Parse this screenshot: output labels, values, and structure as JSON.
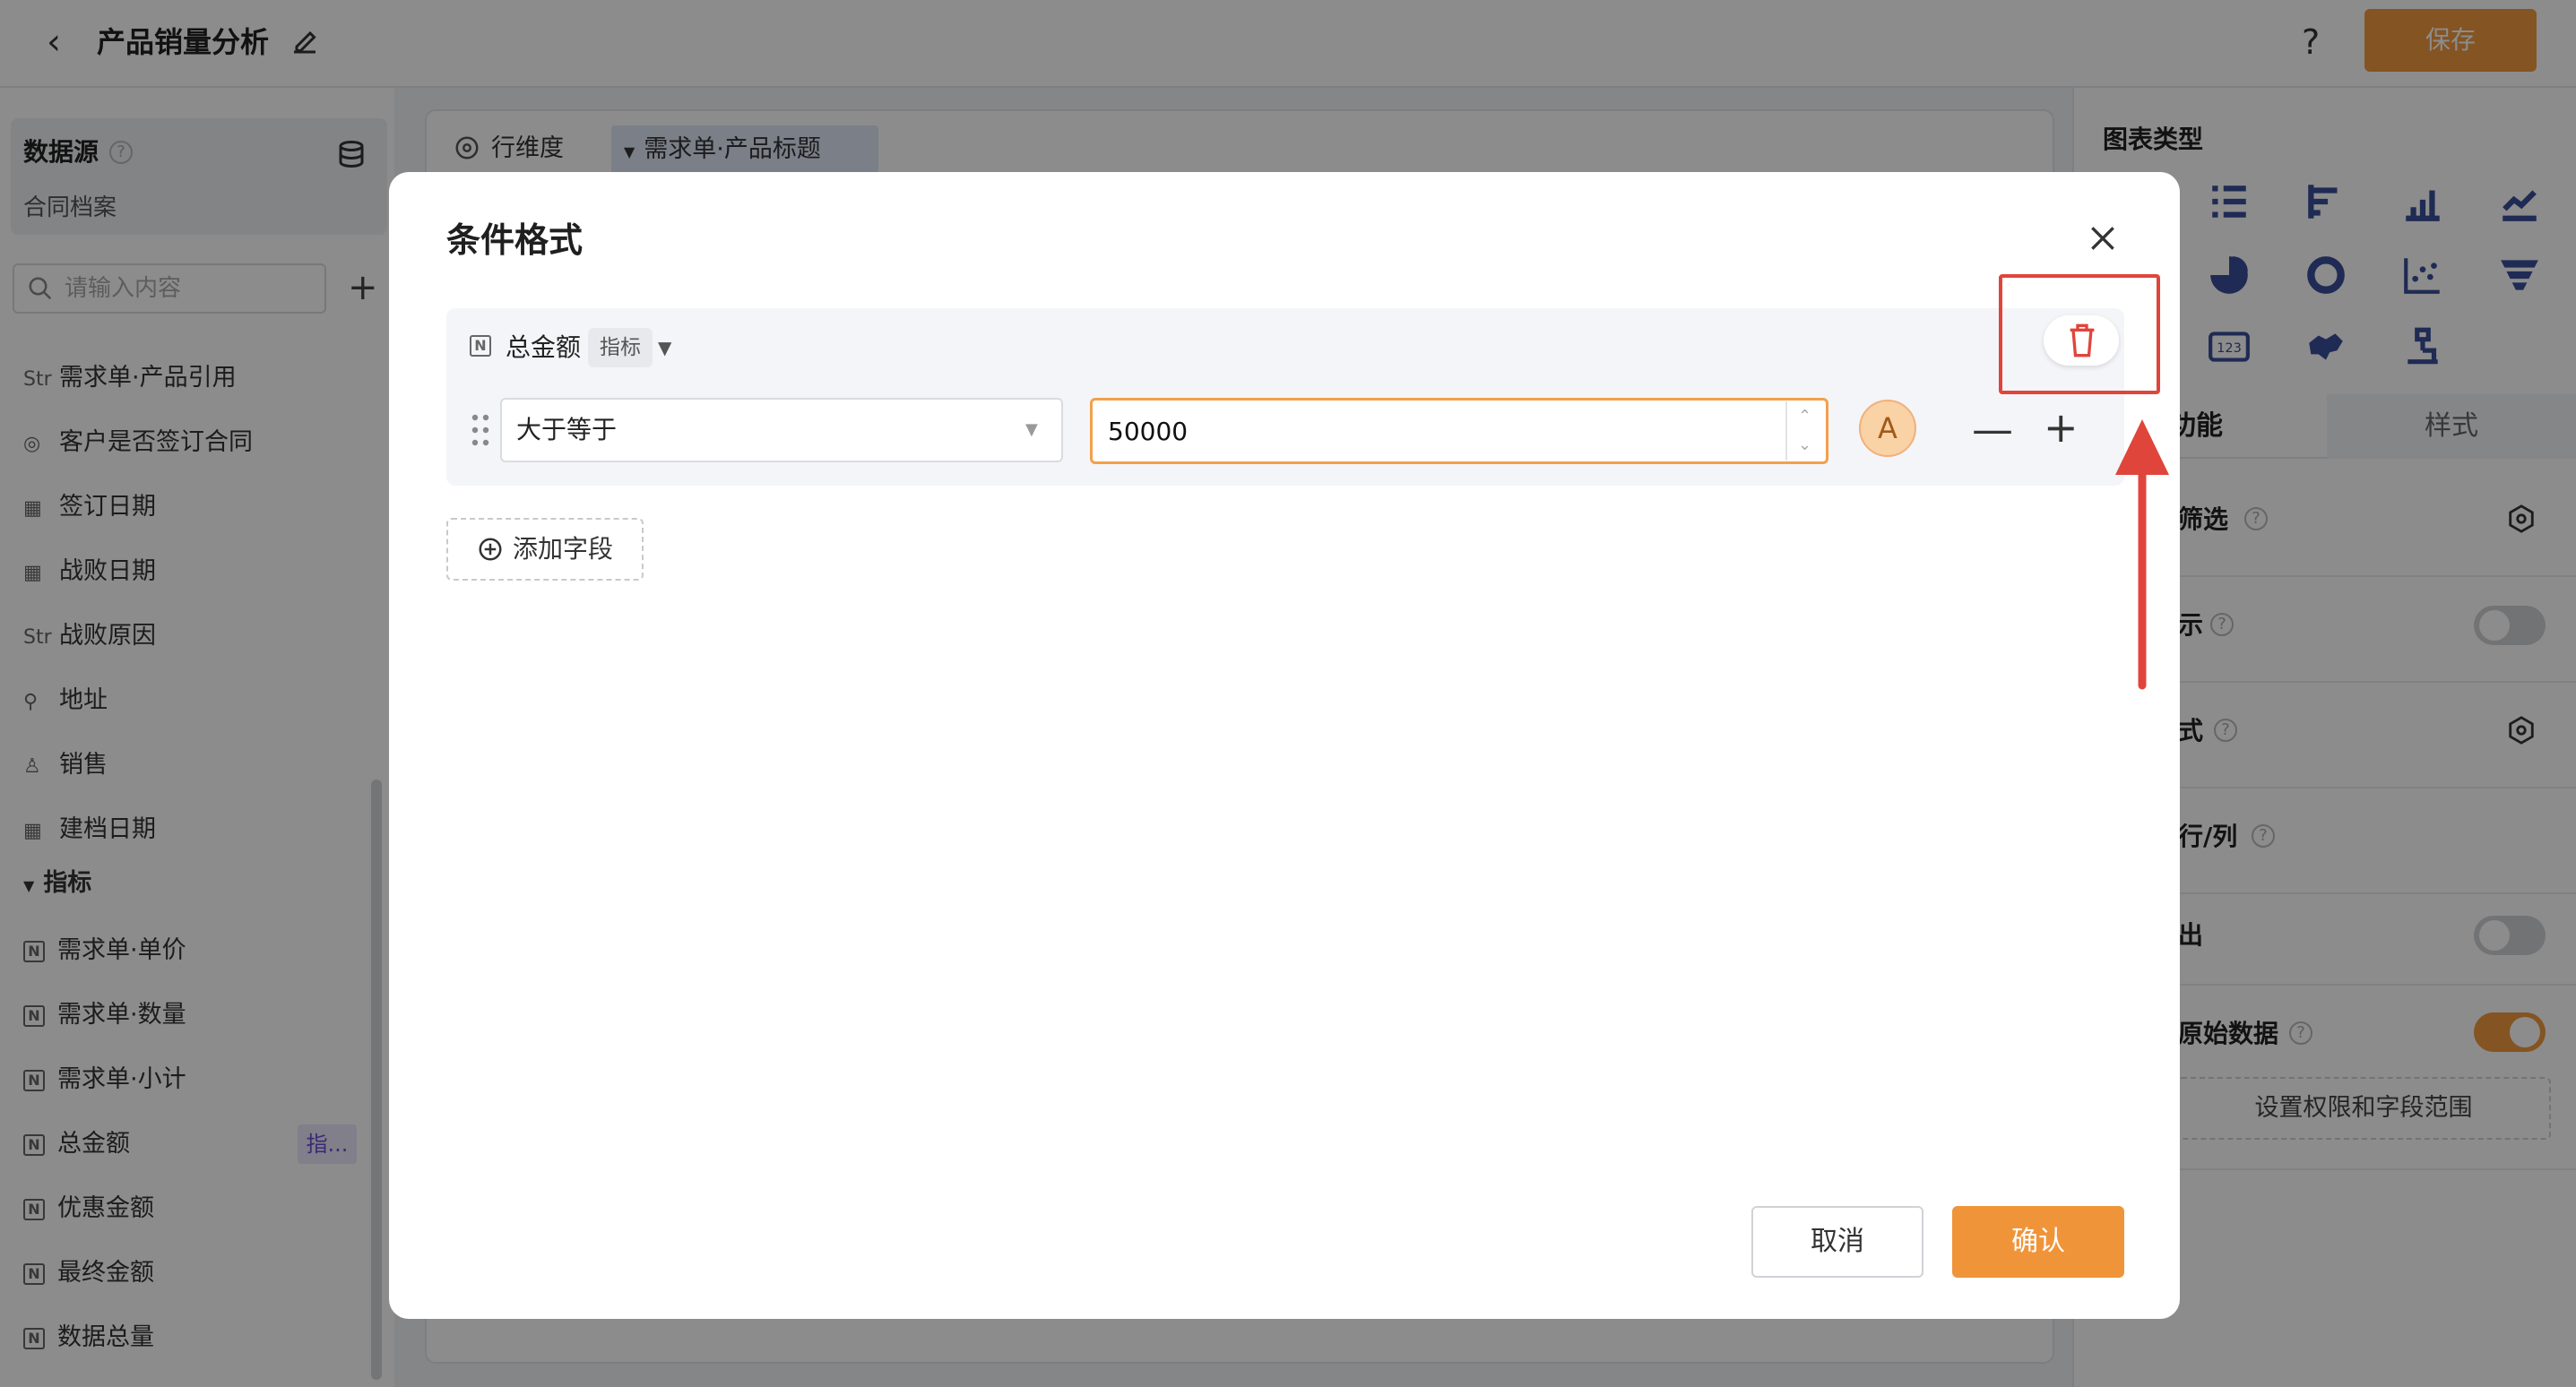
{
  "header": {
    "title": "产品销量分析",
    "help": "?",
    "save_label": "保存"
  },
  "sidebar": {
    "datasource_title": "数据源",
    "datasource_name": "合同档案",
    "search_placeholder": "请输入内容",
    "fields": [
      {
        "icon": "Str",
        "label": "需求单·产品引用"
      },
      {
        "icon": "◎",
        "label": "客户是否签订合同"
      },
      {
        "icon": "▦",
        "label": "签订日期"
      },
      {
        "icon": "▦",
        "label": "战败日期"
      },
      {
        "icon": "Str",
        "label": "战败原因"
      },
      {
        "icon": "⚲",
        "label": "地址"
      },
      {
        "icon": "♙",
        "label": "销售"
      },
      {
        "icon": "▦",
        "label": "建档日期"
      }
    ],
    "metrics_group": "指标",
    "metrics": [
      {
        "label": "需求单·单价"
      },
      {
        "label": "需求单·数量"
      },
      {
        "label": "需求单·小计"
      },
      {
        "label": "总金额"
      },
      {
        "label": "优惠金额"
      },
      {
        "label": "最终金额"
      },
      {
        "label": "数据总量"
      }
    ],
    "metric_tag": "指..."
  },
  "center": {
    "row_dimension_label": "行维度",
    "row_dimension_chip": "需求单·产品标题"
  },
  "right": {
    "chart_type_title": "图表类型",
    "tab_function": "功能",
    "tab_style": "样式",
    "rows": [
      {
        "label": "筛选"
      },
      {
        "label": "示"
      },
      {
        "label": "式"
      },
      {
        "label": "行/列"
      },
      {
        "label": "出"
      },
      {
        "label": "原始数据"
      }
    ],
    "perm_button": "设置权限和字段范围"
  },
  "modal": {
    "title": "条件格式",
    "condition": {
      "field_icon": "N",
      "field_name": "总金额",
      "field_tag": "指标",
      "operator": "大于等于",
      "value": "50000",
      "font_avatar": "A"
    },
    "add_field_label": "添加字段",
    "cancel_label": "取消",
    "confirm_label": "确认"
  },
  "colors": {
    "accent": "#f0943a",
    "highlight": "#e0453b"
  }
}
